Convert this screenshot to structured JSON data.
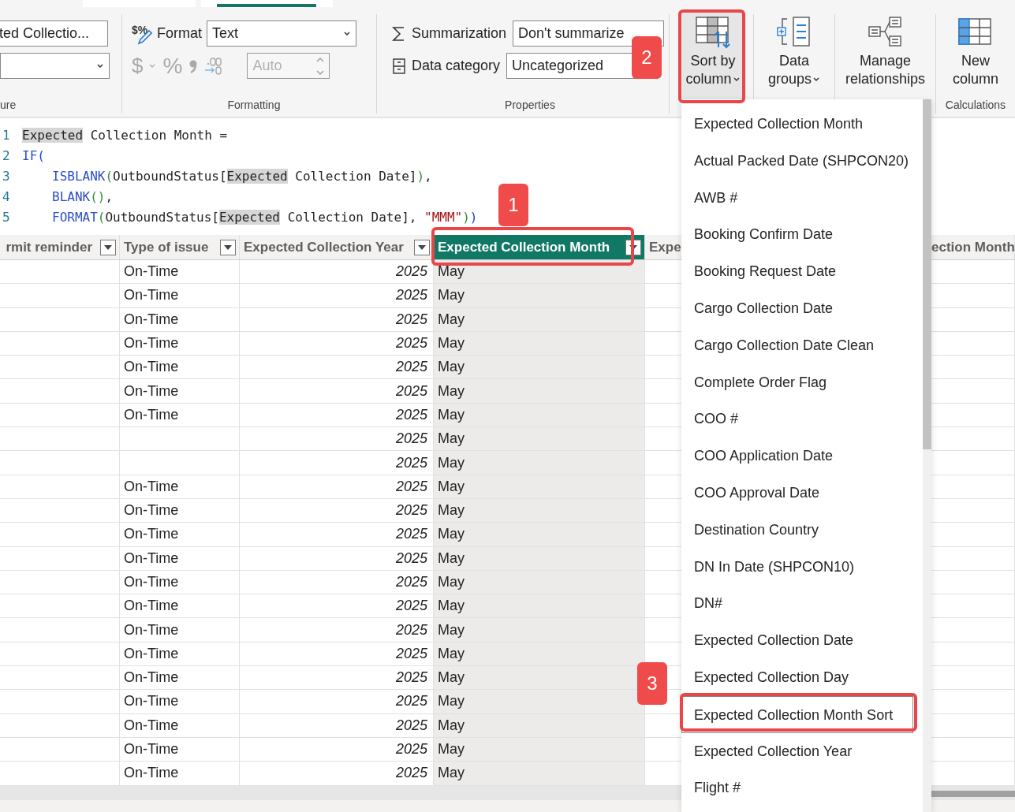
{
  "ribbon": {
    "tabs": [
      {
        "selected": false
      },
      {
        "selected": true
      }
    ],
    "structure": {
      "label": "ure",
      "name_field": {
        "value": "ted Collectio..."
      }
    },
    "formatting": {
      "label": "Formatting",
      "format_icon": "$%",
      "format_label": "Format",
      "format_value": "Text",
      "currency": "$",
      "percent": "%",
      "decimal_places": {
        "value": "Auto",
        "disabled": true
      }
    },
    "properties": {
      "label": "Properties",
      "summarization_label": "Summarization",
      "summarization_value": "Don't summarize",
      "category_label": "Data category",
      "category_value": "Uncategorized"
    },
    "buttons": [
      {
        "kind": "sort",
        "lines": [
          "Sort by",
          "column"
        ],
        "dropdown": true,
        "pressed": true
      },
      {
        "kind": "groups",
        "lines": [
          "Data",
          "groups"
        ],
        "dropdown": true,
        "pressed": false
      },
      {
        "kind": "relationships",
        "lines": [
          "Manage",
          "relationships"
        ],
        "dropdown": false,
        "pressed": false
      },
      {
        "kind": "new-column",
        "lines": [
          "New",
          "column"
        ],
        "dropdown": false,
        "pressed": false
      }
    ],
    "calculations": {
      "label": "Calculations"
    }
  },
  "editor": {
    "lines": [
      {
        "number": "1",
        "indent": false,
        "tokens": [
          {
            "kind": "hl",
            "text": "Expected"
          },
          {
            "kind": "text",
            "text": " Collection Month ="
          }
        ]
      },
      {
        "number": "2",
        "indent": false,
        "tokens": [
          {
            "kind": "kw",
            "text": "IF"
          },
          {
            "kind": "p1",
            "text": "("
          }
        ]
      },
      {
        "number": "3",
        "indent": true,
        "tokens": [
          {
            "kind": "kw",
            "text": "ISBLANK"
          },
          {
            "kind": "p2",
            "text": "("
          },
          {
            "kind": "text",
            "text": "OutboundStatus["
          },
          {
            "kind": "hl",
            "text": "Expected"
          },
          {
            "kind": "text",
            "text": " Collection Date]"
          },
          {
            "kind": "p2",
            "text": ")"
          },
          {
            "kind": "text",
            "text": ","
          }
        ]
      },
      {
        "number": "4",
        "indent": true,
        "tokens": [
          {
            "kind": "kw",
            "text": "BLANK"
          },
          {
            "kind": "p2",
            "text": "()"
          },
          {
            "kind": "text",
            "text": ","
          }
        ]
      },
      {
        "number": "5",
        "indent": true,
        "tokens": [
          {
            "kind": "kw",
            "text": "FORMAT"
          },
          {
            "kind": "p2",
            "text": "("
          },
          {
            "kind": "text",
            "text": "OutboundStatus["
          },
          {
            "kind": "hl",
            "text": "Expected"
          },
          {
            "kind": "text",
            "text": " Collection Date], "
          },
          {
            "kind": "str",
            "text": "\"MMM\""
          },
          {
            "kind": "p2",
            "text": ")"
          },
          {
            "kind": "p1",
            "text": ")"
          }
        ]
      }
    ]
  },
  "table": {
    "columns": [
      {
        "label": "rmit reminder",
        "filter": true,
        "selected": false
      },
      {
        "label": "Type of issue",
        "filter": true,
        "selected": false
      },
      {
        "label": "Expected Collection Year",
        "filter": true,
        "selected": false
      },
      {
        "label": "Expected Collection Month",
        "filter": true,
        "selected": true
      },
      {
        "label": "Expe",
        "selected": false
      },
      {
        "label": "ection Month",
        "selected": false
      }
    ],
    "rows": [
      {
        "type": "On-Time",
        "year": "2025",
        "month": "May"
      },
      {
        "type": "On-Time",
        "year": "2025",
        "month": "May"
      },
      {
        "type": "On-Time",
        "year": "2025",
        "month": "May"
      },
      {
        "type": "On-Time",
        "year": "2025",
        "month": "May"
      },
      {
        "type": "On-Time",
        "year": "2025",
        "month": "May"
      },
      {
        "type": "On-Time",
        "year": "2025",
        "month": "May"
      },
      {
        "type": "On-Time",
        "year": "2025",
        "month": "May"
      },
      {
        "year": "2025",
        "month": "May"
      },
      {
        "year": "2025",
        "month": "May"
      },
      {
        "type": "On-Time",
        "year": "2025",
        "month": "May"
      },
      {
        "type": "On-Time",
        "year": "2025",
        "month": "May"
      },
      {
        "type": "On-Time",
        "year": "2025",
        "month": "May"
      },
      {
        "type": "On-Time",
        "year": "2025",
        "month": "May"
      },
      {
        "type": "On-Time",
        "year": "2025",
        "month": "May"
      },
      {
        "type": "On-Time",
        "year": "2025",
        "month": "May"
      },
      {
        "type": "On-Time",
        "year": "2025",
        "month": "May"
      },
      {
        "type": "On-Time",
        "year": "2025",
        "month": "May"
      },
      {
        "type": "On-Time",
        "year": "2025",
        "month": "May"
      },
      {
        "type": "On-Time",
        "year": "2025",
        "month": "May"
      },
      {
        "type": "On-Time",
        "year": "2025",
        "month": "May"
      },
      {
        "type": "On-Time",
        "year": "2025",
        "month": "May"
      },
      {
        "type": "On-Time",
        "year": "2025",
        "month": "May"
      }
    ]
  },
  "sort_menu": {
    "items": [
      {
        "label": "Expected Collection Month",
        "highlighted": false
      },
      {
        "label": "Actual Packed Date (SHPCON20)",
        "highlighted": false
      },
      {
        "label": "AWB #",
        "highlighted": false
      },
      {
        "label": "Booking Confirm Date",
        "highlighted": false
      },
      {
        "label": "Booking Request Date",
        "highlighted": false
      },
      {
        "label": "Cargo Collection Date",
        "highlighted": false
      },
      {
        "label": "Cargo Collection Date Clean",
        "highlighted": false
      },
      {
        "label": "Complete Order Flag",
        "highlighted": false
      },
      {
        "label": "COO #",
        "highlighted": false
      },
      {
        "label": "COO Application Date",
        "highlighted": false
      },
      {
        "label": "COO Approval Date",
        "highlighted": false
      },
      {
        "label": "Destination Country",
        "highlighted": false
      },
      {
        "label": "DN In Date (SHPCON10)",
        "highlighted": false
      },
      {
        "label": "DN#",
        "highlighted": false
      },
      {
        "label": "Expected Collection Date",
        "highlighted": false
      },
      {
        "label": "Expected Collection Day",
        "highlighted": false
      },
      {
        "label": "Expected Collection Month Sort",
        "highlighted": true
      },
      {
        "label": "Expected Collection Year",
        "highlighted": false
      },
      {
        "label": "Flight #",
        "highlighted": false
      }
    ]
  },
  "annotations": [
    {
      "label": "1"
    },
    {
      "label": "2"
    },
    {
      "label": "3"
    }
  ]
}
